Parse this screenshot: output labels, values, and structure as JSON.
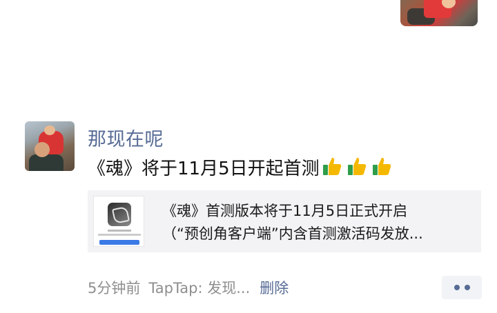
{
  "post": {
    "username": "那现在呢",
    "text": "《魂》将于11月5日开起首测",
    "emoji": [
      "thumbs-up",
      "thumbs-up",
      "thumbs-up"
    ]
  },
  "link_card": {
    "line1": "《魂》首测版本将于11月5日正式开启",
    "line2": "（“预创角客户端”内含首测激活码发放..."
  },
  "footer": {
    "time": "5分钟前",
    "source": "TapTap: 发现...",
    "delete_label": "删除"
  },
  "colors": {
    "link_blue": "#576b95",
    "card_bg": "#f3f3f5",
    "more_button_bg": "#f1f3f6"
  }
}
